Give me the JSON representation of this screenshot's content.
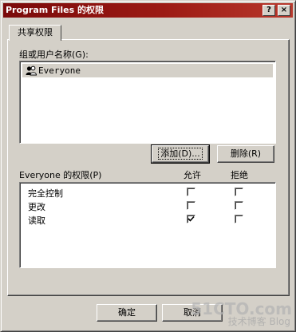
{
  "window": {
    "title": "Program Files 的权限",
    "help_button": "?",
    "close_button": "×"
  },
  "tabs": [
    {
      "label": "共享权限"
    }
  ],
  "users": {
    "label": "组或用户名称(G):",
    "items": [
      {
        "name": "Everyone",
        "selected": true
      }
    ]
  },
  "buttons": {
    "add": "添加(D)...",
    "remove": "删除(R)",
    "ok": "确定",
    "cancel": "取消"
  },
  "permissions": {
    "label": "Everyone 的权限(P)",
    "allow_header": "允许",
    "deny_header": "拒绝",
    "rows": [
      {
        "name": "完全控制",
        "allow": false,
        "deny": false
      },
      {
        "name": "更改",
        "allow": false,
        "deny": false
      },
      {
        "name": "读取",
        "allow": true,
        "deny": false
      }
    ]
  },
  "watermark": {
    "line1": "51CTO.com",
    "line2": "技术博客 Blog"
  }
}
